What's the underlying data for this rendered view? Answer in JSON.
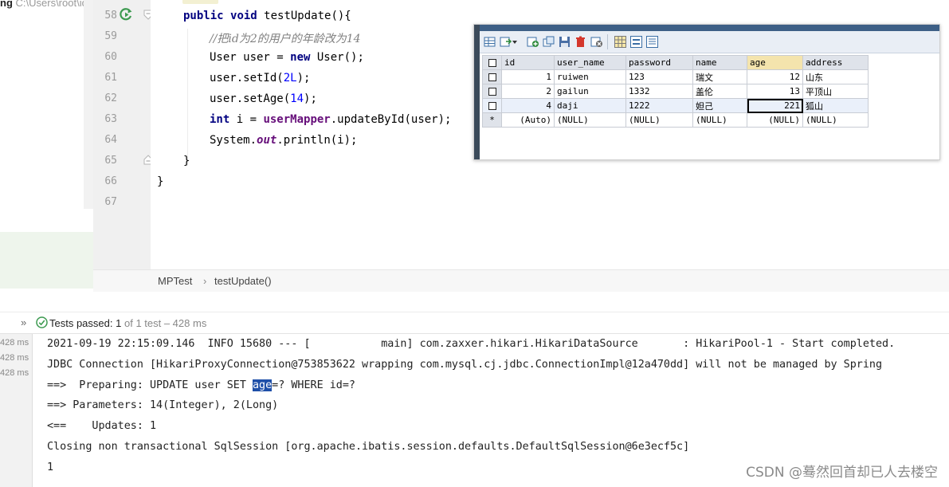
{
  "project": {
    "name": "ng",
    "path": "C:\\Users\\root\\id"
  },
  "editor": {
    "line_numbers": [
      "58",
      "59",
      "60",
      "61",
      "62",
      "63",
      "64",
      "65",
      "66",
      "67"
    ],
    "code": {
      "l58_kw1": "public",
      "l58_kw2": "void",
      "l58_rest": " testUpdate(){",
      "l59_comment": "//把id为2的用户的年龄改为14",
      "l60_a": "User user = ",
      "l60_kw": "new",
      "l60_b": " User();",
      "l61_a": "user.setId(",
      "l61_num": "2L",
      "l61_b": ");",
      "l62_a": "user.setAge(",
      "l62_num": "14",
      "l62_b": ");",
      "l63_kw": "int",
      "l63_a": " i = ",
      "l63_field": "userMapper",
      "l63_b": ".updateById(user);",
      "l64_a": "System.",
      "l64_field": "out",
      "l64_b": ".println(i);",
      "l65": "}",
      "l66": "}"
    }
  },
  "db_grid": {
    "columns": [
      "id",
      "user_name",
      "password",
      "name",
      "age",
      "address"
    ],
    "rows": [
      {
        "id": "1",
        "user_name": "ruiwen",
        "password": "123",
        "name": "瑞文",
        "age": "12",
        "address": "山东"
      },
      {
        "id": "2",
        "user_name": "gailun",
        "password": "1332",
        "name": "盖伦",
        "age": "13",
        "address": "平顶山"
      },
      {
        "id": "4",
        "user_name": "daji",
        "password": "1222",
        "name": "妲己",
        "age": "221",
        "address": "狐山"
      }
    ],
    "new_row": {
      "marker": "*",
      "id": "(Auto)",
      "user_name": "(NULL)",
      "password": "(NULL)",
      "name": "(NULL)",
      "age": "(NULL)",
      "address": "(NULL)"
    }
  },
  "breadcrumb": {
    "class": "MPTest",
    "separator": "›",
    "method": "testUpdate()"
  },
  "test_bar": {
    "chevron": "»",
    "passed_label": "Tests passed:",
    "passed_count": "1",
    "of_text": "of 1 test – 428 ms"
  },
  "console": {
    "times": [
      "428 ms",
      "428 ms",
      "428 ms"
    ],
    "lines": [
      "2021-09-19 22:15:09.146  INFO 15680 --- [           main] com.zaxxer.hikari.HikariDataSource       : HikariPool-1 - Start completed.",
      "JDBC Connection [HikariProxyConnection@753853622 wrapping com.mysql.cj.jdbc.ConnectionImpl@12a470dd] will not be managed by Spring",
      "==> Parameters: 14(Integer), 2(Long)",
      "<==    Updates: 1",
      "Closing non transactional SqlSession [org.apache.ibatis.session.defaults.DefaultSqlSession@6e3ecf5c]",
      "1"
    ],
    "prep_a": "==>  Preparing: UPDATE user SET ",
    "prep_hl": "age",
    "prep_b": "=? WHERE id=?"
  },
  "watermark": "CSDN @蓦然回首却已人去楼空",
  "colors": {
    "keyword": "#000080",
    "field": "#660e7a",
    "number": "#0000ff",
    "comment": "#808080",
    "pass_green": "#3d9a50",
    "selection": "#1e4fa8"
  }
}
